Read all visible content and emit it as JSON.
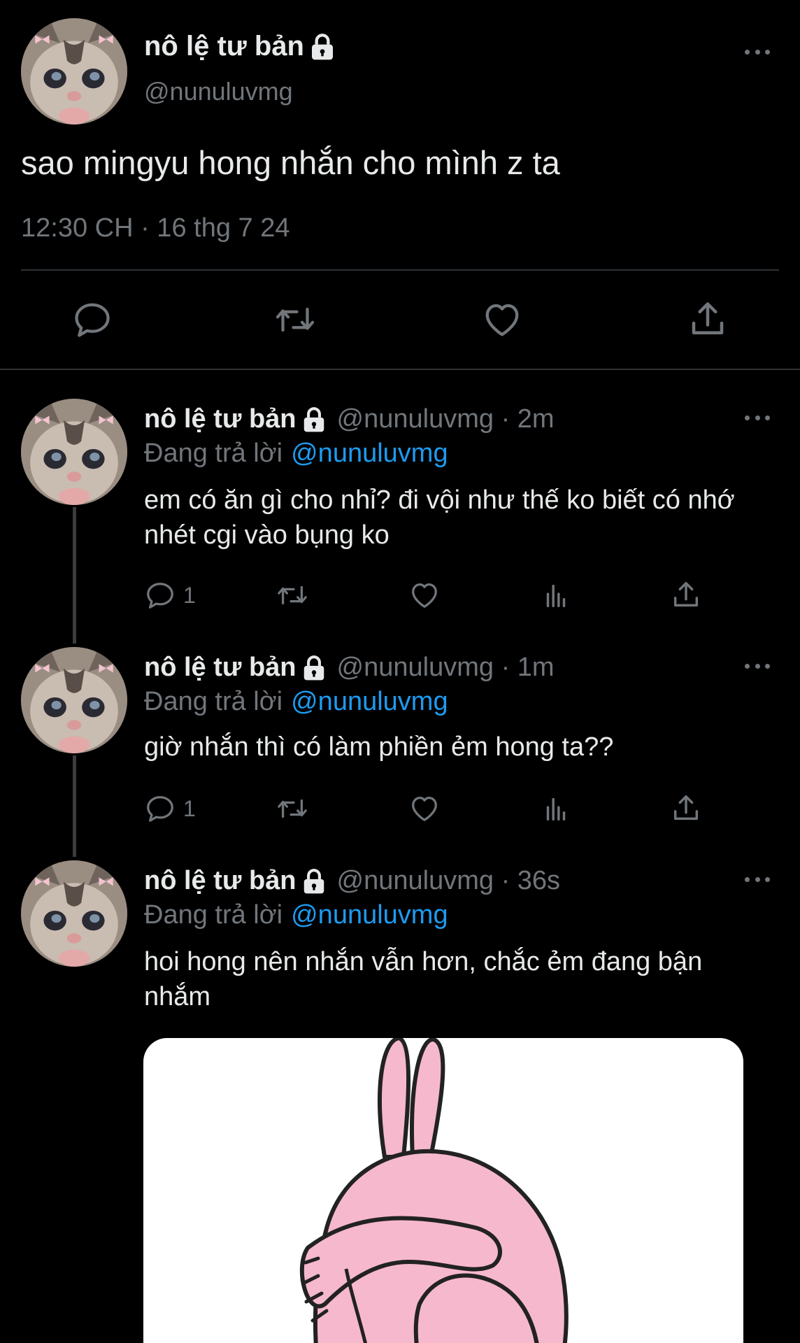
{
  "main_tweet": {
    "name": "nô lệ tư bản",
    "handle": "@nunuluvmg",
    "text": "sao mingyu hong nhắn cho mình z ta",
    "time": "12:30 CH · 16 thg 7 24",
    "actions": [
      "reply-icon",
      "retweet-icon",
      "like-icon",
      "share-icon"
    ]
  },
  "replies": [
    {
      "name": "nô lệ tư bản",
      "handle_time": "@nunuluvmg · 2m",
      "replying_label": "Đang trả lời",
      "replying_handle": "@nunuluvmg",
      "text": "em có ăn gì cho nhỉ? đi vội như thế ko biết có nhớ nhét cgi vào bụng ko",
      "reply_count": "1"
    },
    {
      "name": "nô lệ tư bản",
      "handle_time": "@nunuluvmg · 1m",
      "replying_label": "Đang trả lời",
      "replying_handle": "@nunuluvmg",
      "text": "giờ nhắn thì có làm phiền ẻm hong ta??",
      "reply_count": "1"
    },
    {
      "name": "nô lệ tư bản",
      "handle_time": "@nunuluvmg · 36s",
      "replying_label": "Đang trả lời",
      "replying_handle": "@nunuluvmg",
      "text": "hoi hong nên nhắn vẫn hơn, chắc ẻm đang bận nhắm",
      "media": "pink-bunny-sticker"
    }
  ],
  "colors": {
    "background": "#000000",
    "text": "#e7e9ea",
    "secondary": "#71767b",
    "mention": "#1d9bf0",
    "divider": "#2f3336"
  }
}
